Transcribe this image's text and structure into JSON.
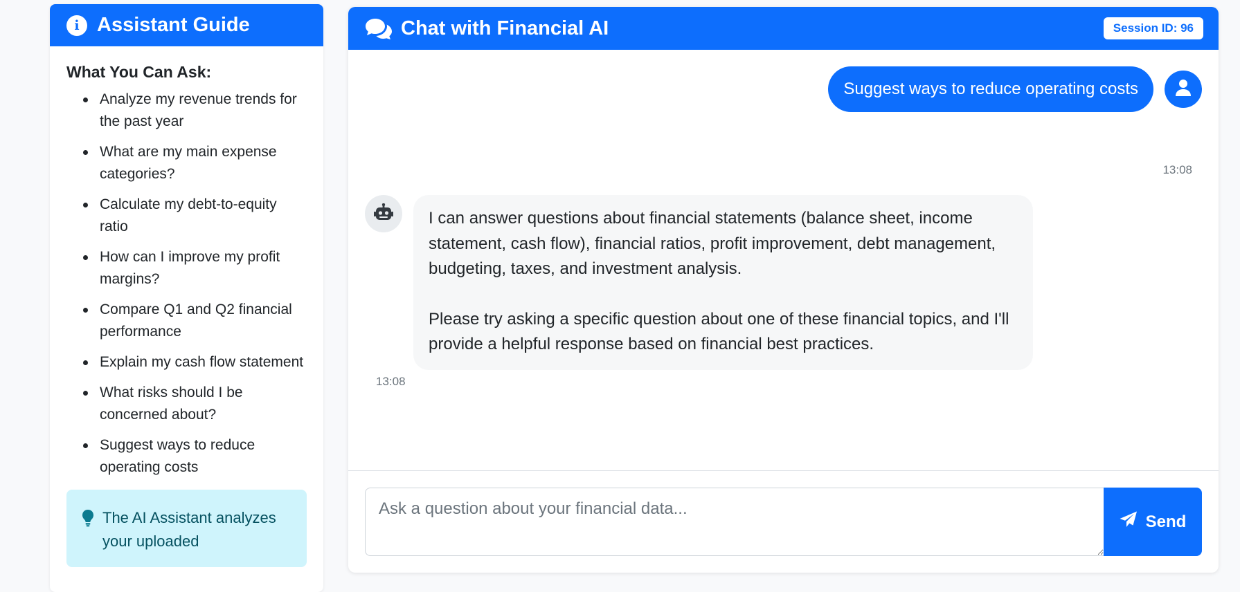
{
  "guide": {
    "title": "Assistant Guide",
    "section_title": "What You Can Ask:",
    "items": [
      "Analyze my revenue trends for the past year",
      "What are my main expense categories?",
      "Calculate my debt-to-equity ratio",
      "How can I improve my profit margins?",
      "Compare Q1 and Q2 financial performance",
      "Explain my cash flow statement",
      "What risks should I be concerned about?",
      "Suggest ways to reduce operating costs"
    ],
    "tip": "The AI Assistant analyzes your uploaded"
  },
  "chat": {
    "title": "Chat with Financial AI",
    "session_badge": "Session ID: 96",
    "user_message": {
      "text": "Suggest ways to reduce operating costs",
      "time": "13:08"
    },
    "bot_message": {
      "paragraph1": "I can answer questions about financial statements (balance sheet, income statement, cash flow), financial ratios, profit improvement, debt management, budgeting, taxes, and investment analysis.",
      "paragraph2": "Please try asking a specific question about one of these financial topics, and I'll provide a helpful response based on financial best practices.",
      "time": "13:08"
    },
    "input_placeholder": "Ask a question about your financial data...",
    "send_label": "Send"
  },
  "icons": {
    "guide_header": "info-circle-icon",
    "tip": "lightbulb-icon",
    "chat_header": "comments-icon",
    "user_avatar": "user-icon",
    "bot_avatar": "robot-icon",
    "send": "paper-plane-icon"
  },
  "colors": {
    "primary": "#0d6efd",
    "tip_background": "#cff4fc",
    "tip_text": "#055160",
    "bot_bubble": "#f6f7f8"
  }
}
